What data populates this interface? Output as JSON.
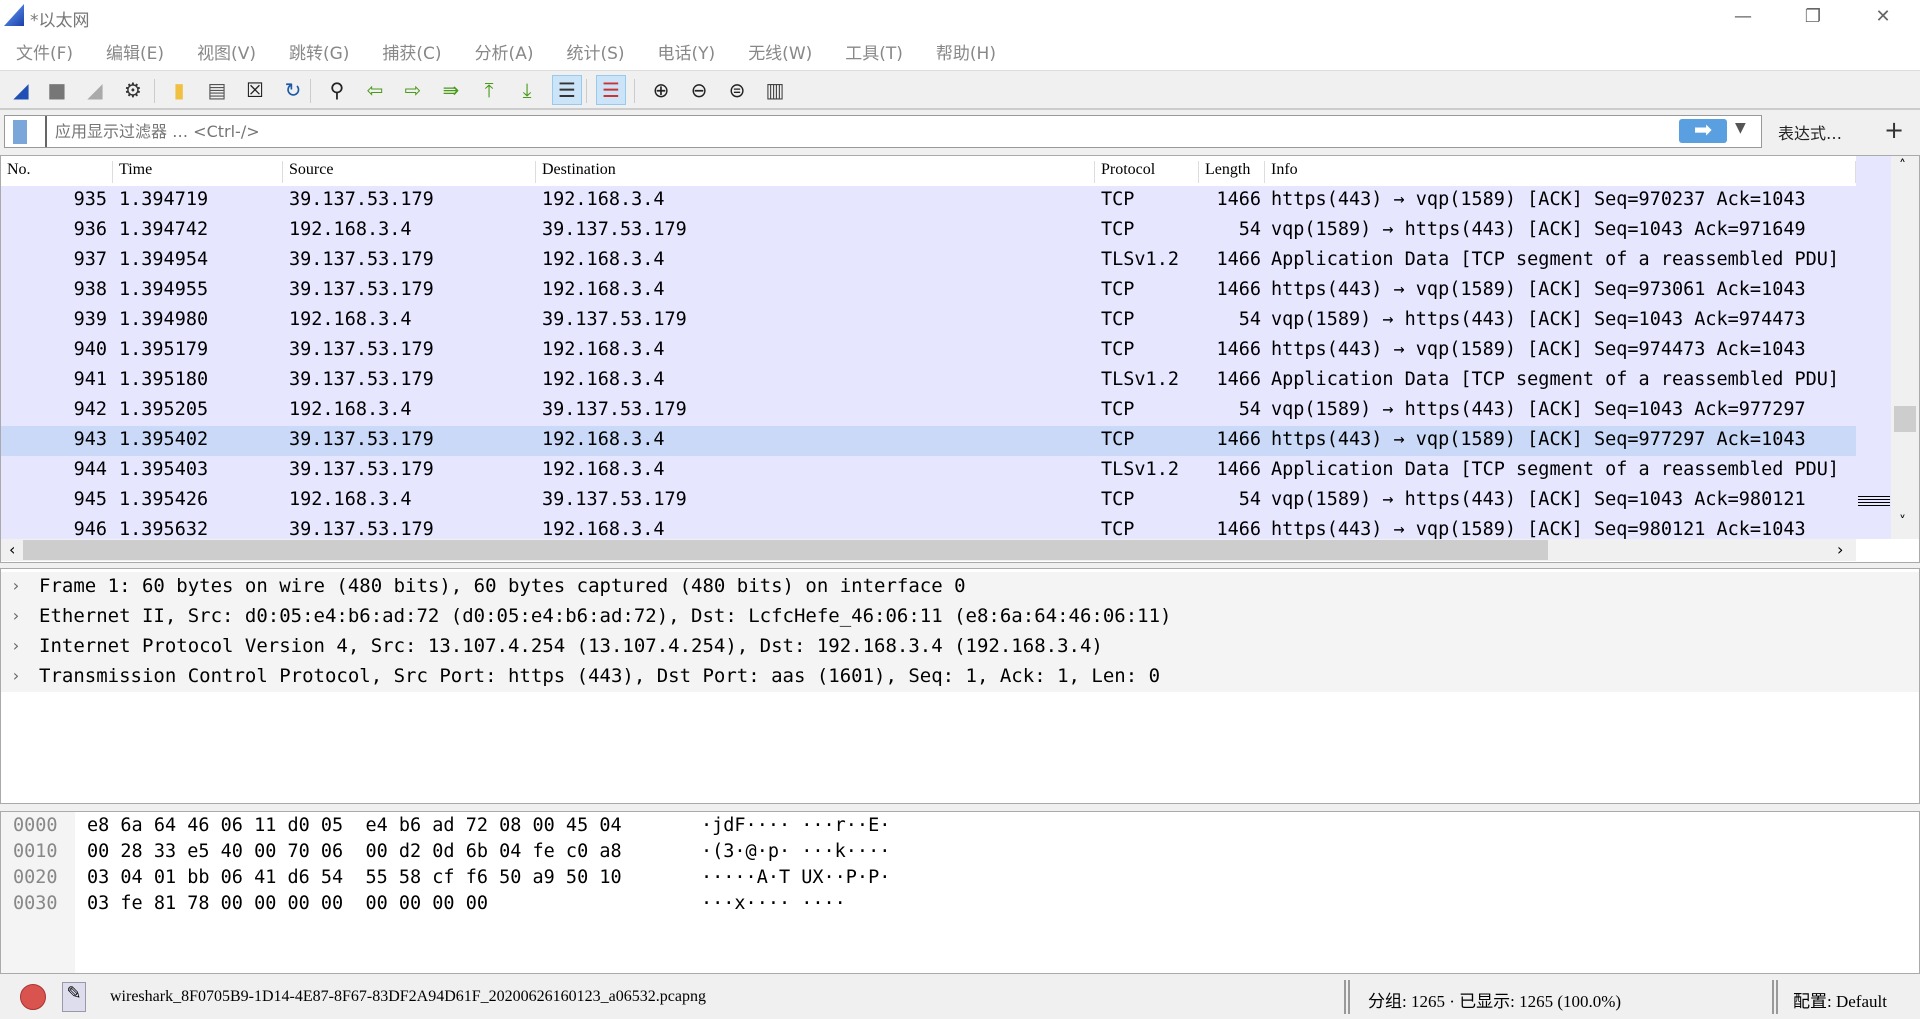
{
  "window": {
    "title": "*以太网",
    "minimize": "—",
    "restore": "❐",
    "close": "✕"
  },
  "menu": [
    "文件(F)",
    "编辑(E)",
    "视图(V)",
    "跳转(G)",
    "捕获(C)",
    "分析(A)",
    "统计(S)",
    "电话(Y)",
    "无线(W)",
    "工具(T)",
    "帮助(H)"
  ],
  "toolbar": [
    {
      "icon": "shark-fin-start-icon",
      "glyph": "◢",
      "color": "#1f4fb4"
    },
    {
      "icon": "stop-icon",
      "glyph": "■",
      "color": "#777"
    },
    {
      "icon": "restart-icon",
      "glyph": "◢",
      "color": "#aaa"
    },
    {
      "icon": "capture-options-gear-icon",
      "glyph": "⚙",
      "color": "#333"
    },
    {
      "icon": "open-folder-icon",
      "glyph": "▮",
      "color": "#f0c040"
    },
    {
      "icon": "save-file-icon",
      "glyph": "▤",
      "color": "#555"
    },
    {
      "icon": "close-file-icon",
      "glyph": "☒",
      "color": "#222"
    },
    {
      "icon": "reload-icon",
      "glyph": "↻",
      "color": "#1a5aa8"
    },
    {
      "icon": "find-packet-icon",
      "glyph": "⚲",
      "color": "#222"
    },
    {
      "icon": "go-back-icon",
      "glyph": "⇦",
      "color": "#4a9a1a"
    },
    {
      "icon": "go-forward-icon",
      "glyph": "⇨",
      "color": "#4a9a1a"
    },
    {
      "icon": "go-to-packet-icon",
      "glyph": "⇛",
      "color": "#4a9a1a"
    },
    {
      "icon": "first-packet-icon",
      "glyph": "⤒",
      "color": "#4a9a1a"
    },
    {
      "icon": "last-packet-icon",
      "glyph": "⤓",
      "color": "#4a9a1a"
    },
    {
      "icon": "autoscroll-icon",
      "glyph": "☰",
      "color": "#333"
    },
    {
      "icon": "colorize-icon",
      "glyph": "☰",
      "color": "#c33"
    },
    {
      "icon": "zoom-in-icon",
      "glyph": "⊕",
      "color": "#222"
    },
    {
      "icon": "zoom-out-icon",
      "glyph": "⊖",
      "color": "#222"
    },
    {
      "icon": "normal-size-icon",
      "glyph": "⊜",
      "color": "#222"
    },
    {
      "icon": "resize-columns-icon",
      "glyph": "▥",
      "color": "#444"
    }
  ],
  "filter": {
    "placeholder": "应用显示过滤器 … <Ctrl-/>",
    "apply": "➡",
    "dropdown": "▼",
    "expression": "表达式…",
    "add": "+"
  },
  "packet_list": {
    "columns": [
      "No.",
      "Time",
      "Source",
      "Destination",
      "Protocol",
      "Length",
      "Info"
    ],
    "selected_no": "943",
    "row_color": "#e7e6ff",
    "selected_color": "#cad9f7",
    "rows": [
      [
        "935",
        "1.394719",
        "39.137.53.179",
        "192.168.3.4",
        "TCP",
        "1466",
        "https(443) → vqp(1589) [ACK] Seq=970237 Ack=1043"
      ],
      [
        "936",
        "1.394742",
        "192.168.3.4",
        "39.137.53.179",
        "TCP",
        "54",
        "vqp(1589) → https(443) [ACK] Seq=1043 Ack=971649"
      ],
      [
        "937",
        "1.394954",
        "39.137.53.179",
        "192.168.3.4",
        "TLSv1.2",
        "1466",
        "Application Data [TCP segment of a reassembled PDU]"
      ],
      [
        "938",
        "1.394955",
        "39.137.53.179",
        "192.168.3.4",
        "TCP",
        "1466",
        "https(443) → vqp(1589) [ACK] Seq=973061 Ack=1043"
      ],
      [
        "939",
        "1.394980",
        "192.168.3.4",
        "39.137.53.179",
        "TCP",
        "54",
        "vqp(1589) → https(443) [ACK] Seq=1043 Ack=974473"
      ],
      [
        "940",
        "1.395179",
        "39.137.53.179",
        "192.168.3.4",
        "TCP",
        "1466",
        "https(443) → vqp(1589) [ACK] Seq=974473 Ack=1043"
      ],
      [
        "941",
        "1.395180",
        "39.137.53.179",
        "192.168.3.4",
        "TLSv1.2",
        "1466",
        "Application Data [TCP segment of a reassembled PDU]"
      ],
      [
        "942",
        "1.395205",
        "192.168.3.4",
        "39.137.53.179",
        "TCP",
        "54",
        "vqp(1589) → https(443) [ACK] Seq=1043 Ack=977297"
      ],
      [
        "943",
        "1.395402",
        "39.137.53.179",
        "192.168.3.4",
        "TCP",
        "1466",
        "https(443) → vqp(1589) [ACK] Seq=977297 Ack=1043"
      ],
      [
        "944",
        "1.395403",
        "39.137.53.179",
        "192.168.3.4",
        "TLSv1.2",
        "1466",
        "Application Data [TCP segment of a reassembled PDU]"
      ],
      [
        "945",
        "1.395426",
        "192.168.3.4",
        "39.137.53.179",
        "TCP",
        "54",
        "vqp(1589) → https(443) [ACK] Seq=1043 Ack=980121"
      ],
      [
        "946",
        "1.395632",
        "39.137.53.179",
        "192.168.3.4",
        "TCP",
        "1466",
        "https(443) → vqp(1589) [ACK] Seq=980121 Ack=1043"
      ]
    ]
  },
  "details": [
    "Frame 1: 60 bytes on wire (480 bits), 60 bytes captured (480 bits) on interface 0",
    "Ethernet II, Src: d0:05:e4:b6:ad:72 (d0:05:e4:b6:ad:72), Dst: LcfcHefe_46:06:11 (e8:6a:64:46:06:11)",
    "Internet Protocol Version 4, Src: 13.107.4.254 (13.107.4.254), Dst: 192.168.3.4 (192.168.3.4)",
    "Transmission Control Protocol, Src Port: https (443), Dst Port: aas (1601), Seq: 1, Ack: 1, Len: 0"
  ],
  "hex": [
    {
      "offset": "0000",
      "bytes": "e8 6a 64 46 06 11 d0 05  e4 b6 ad 72 08 00 45 04",
      "ascii": "·jdF···· ···r··E·"
    },
    {
      "offset": "0010",
      "bytes": "00 28 33 e5 40 00 70 06  00 d2 0d 6b 04 fe c0 a8",
      "ascii": "·(3·@·p· ···k····"
    },
    {
      "offset": "0020",
      "bytes": "03 04 01 bb 06 41 d6 54  55 58 cf f6 50 a9 50 10",
      "ascii": "·····A·T UX··P·P·"
    },
    {
      "offset": "0030",
      "bytes": "03 fe 81 78 00 00 00 00  00 00 00 00",
      "ascii": "···x···· ····"
    }
  ],
  "status": {
    "file": "wireshark_8F0705B9-1D14-4E87-8F67-83DF2A94D61F_20200626160123_a06532.pcapng",
    "counts": "分组: 1265 · 已显示: 1265 (100.0%)",
    "profile": "配置: Default"
  }
}
